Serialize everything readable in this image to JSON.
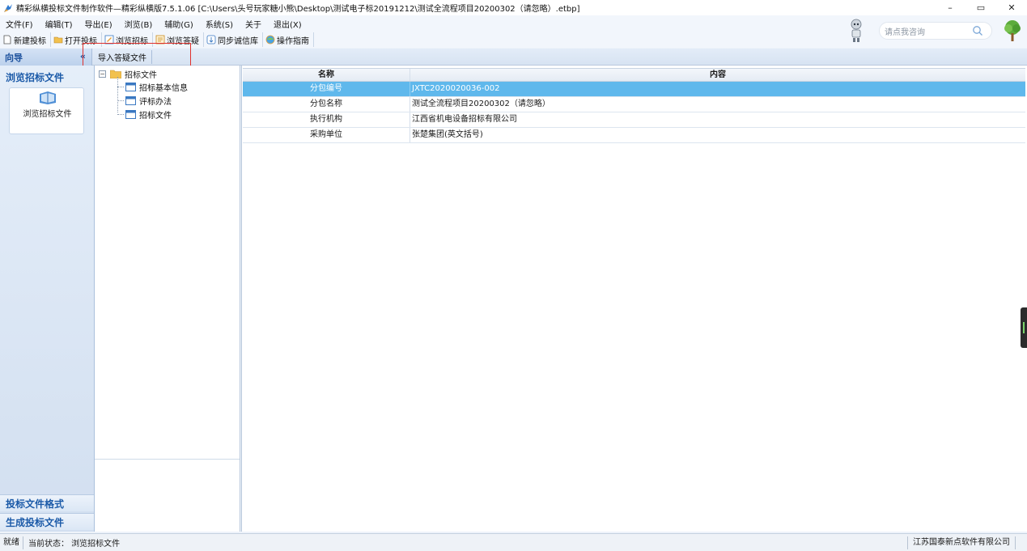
{
  "window": {
    "title": "精彩纵横投标文件制作软件—精彩纵横版7.5.1.06   [C:\\Users\\头号玩家糖小熊\\Desktop\\测试电子标20191212\\测试全流程项目20200302（请忽略）.etbp]",
    "minimize": "–",
    "restore": "▭",
    "close": "✕"
  },
  "menu": [
    "文件(F)",
    "编辑(T)",
    "导出(E)",
    "浏览(B)",
    "辅助(G)",
    "系统(S)",
    "关于",
    "退出(X)"
  ],
  "toolbar": {
    "new_bid": "新建投标",
    "open_bid": "打开投标",
    "browse_tender": "浏览招标",
    "browse_qa": "浏览答疑",
    "sync_integrity": "同步诚信库",
    "guide": "操作指南"
  },
  "search": {
    "placeholder": "请点我咨询"
  },
  "tabs": {
    "nav_head": "向导",
    "collapse": "«",
    "import_qa": "导入答疑文件"
  },
  "leftnav": {
    "section_top": "浏览招标文件",
    "card_label": "浏览招标文件",
    "section_format": "投标文件格式",
    "section_generate": "生成投标文件"
  },
  "tree": {
    "root": "招标文件",
    "children": [
      "招标基本信息",
      "评标办法",
      "招标文件"
    ]
  },
  "grid": {
    "headers": [
      "名称",
      "内容"
    ],
    "rows": [
      [
        "分包编号",
        "JXTC2020020036-002"
      ],
      [
        "分包名称",
        "测试全流程项目20200302（请忽略）"
      ],
      [
        "执行机构",
        "江西省机电设备招标有限公司"
      ],
      [
        "采购单位",
        "张楚集团(英文括号)"
      ]
    ],
    "selected_row": 0
  },
  "status": {
    "ready": "就绪",
    "state": "当前状态：  浏览招标文件",
    "company": "江苏国泰新点软件有限公司"
  },
  "colors": {
    "selected_row": "#5fb8ec",
    "nav_title": "#1b5aa8",
    "highlight_box": "#e0312d"
  }
}
